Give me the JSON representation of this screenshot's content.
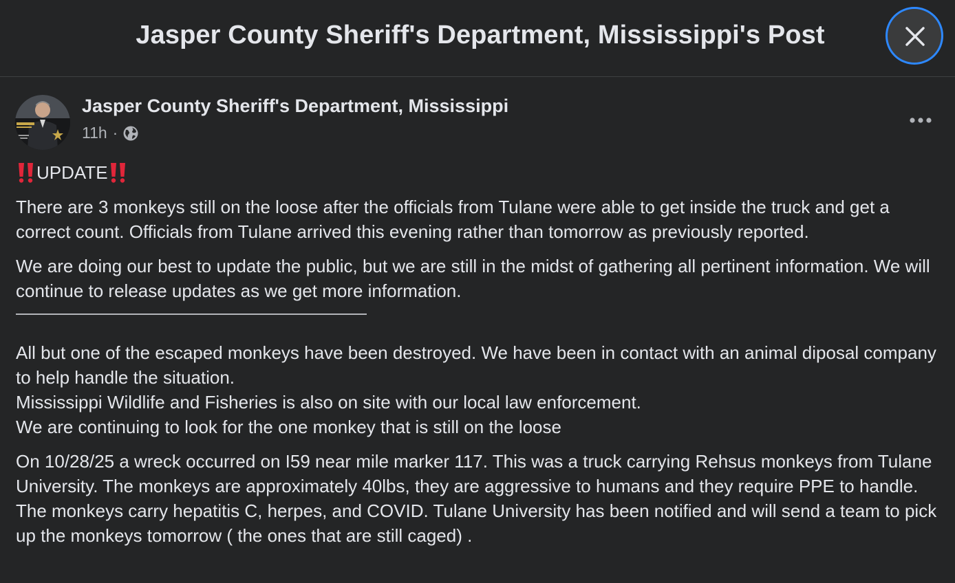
{
  "dialog": {
    "title": "Jasper County Sheriff's Department, Mississippi's Post",
    "close_icon": "close-icon"
  },
  "post": {
    "author": "Jasper County Sheriff's Department, Mississippi",
    "timestamp": "11h",
    "separator": "·",
    "audience_icon": "globe-icon",
    "more_icon": "more-options-icon",
    "avatar_icon": "profile-photo",
    "update_heading": "UPDATE",
    "emoji": "double-exclamation-icon",
    "paragraphs": {
      "p1": "There are 3 monkeys still on the loose after the officials from Tulane were able to get inside the truck and get a correct count.  Officials from Tulane arrived this evening rather than tomorrow as previously reported.",
      "p2": "We are doing our best to update the public, but we are still in the midst of gathering all pertinent information. We will continue to release updates as we get more information.",
      "p3a": "All but one of the escaped monkeys have been destroyed. We have been in contact with an animal diposal company to help handle the situation.",
      "p3b": "Mississippi Wildlife and Fisheries is also on site with our local law enforcement.",
      "p3c": "We are continuing to look for the one monkey that is still on the loose",
      "p4": "On 10/28/25 a wreck occurred on I59 near mile marker 117. This was a truck carrying Rehsus monkeys from Tulane University. The monkeys are approximately 40lbs, they are aggressive to humans and they require PPE to handle. The monkeys carry hepatitis C, herpes, and COVID. Tulane University has been notified and will send a team to pick up the monkeys tomorrow ( the ones that are still caged) ."
    }
  },
  "colors": {
    "background": "#242526",
    "text": "#e4e6eb",
    "secondary_text": "#b0b3b8",
    "focus_ring": "#2d88ff",
    "emoji_red": "#e0263a"
  }
}
